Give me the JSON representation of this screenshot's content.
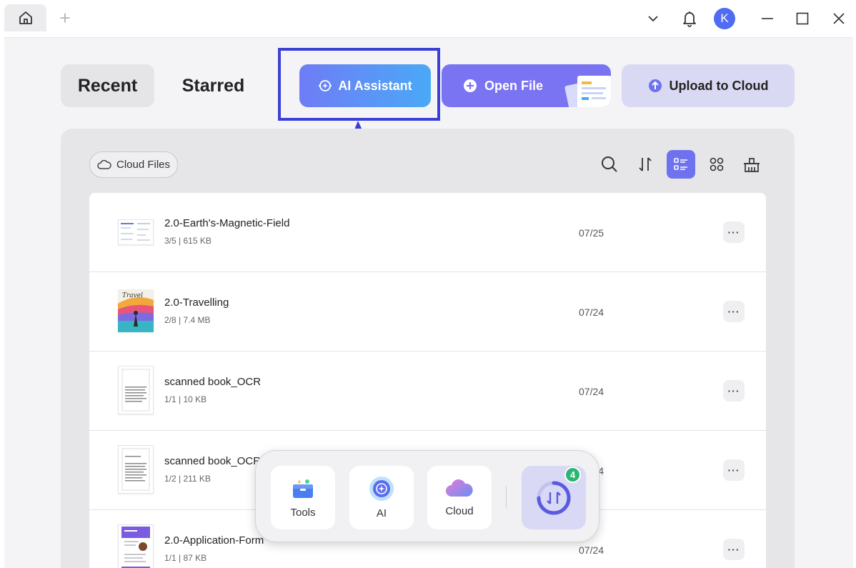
{
  "titlebar": {
    "avatar_initial": "K",
    "new_tab_symbol": "+",
    "icons": [
      "home-icon",
      "chevron-down-icon",
      "bell-icon",
      "minimize-icon",
      "maximize-icon",
      "close-icon"
    ]
  },
  "tabs": {
    "recent": "Recent",
    "starred": "Starred"
  },
  "actions": {
    "ai_assistant": "AI Assistant",
    "open_file": "Open File",
    "upload_to_cloud": "Upload to Cloud"
  },
  "toolbar": {
    "cloud_files": "Cloud Files",
    "icons": [
      "search-icon",
      "sort-icon",
      "list-view-icon",
      "grid-view-icon",
      "clear-icon"
    ],
    "active_view": "list"
  },
  "files": [
    {
      "name": "2.0-Earth's-Magnetic-Field",
      "meta": "3/5 | 615 KB",
      "date": "07/25",
      "more": "···"
    },
    {
      "name": "2.0-Travelling",
      "meta": "2/8 | 7.4 MB",
      "date": "07/24",
      "more": "···"
    },
    {
      "name": "scanned book_OCR",
      "meta": "1/1 | 10 KB",
      "date": "07/24",
      "more": "···"
    },
    {
      "name": "scanned book_OCR_",
      "meta": "1/2 | 211 KB",
      "date": "07/24",
      "more": "···"
    },
    {
      "name": "2.0-Application-Form",
      "meta": "1/1 | 87 KB",
      "date": "07/24",
      "more": "···"
    }
  ],
  "dock": {
    "tools": "Tools",
    "ai": "AI",
    "cloud": "Cloud",
    "convert_badge": "4"
  },
  "colors": {
    "accent": "#6f72ee",
    "ai_gradient_start": "#6f7cf6",
    "ai_gradient_end": "#4aa9f6",
    "annotation": "#3b40d4",
    "badge": "#2bb673"
  }
}
